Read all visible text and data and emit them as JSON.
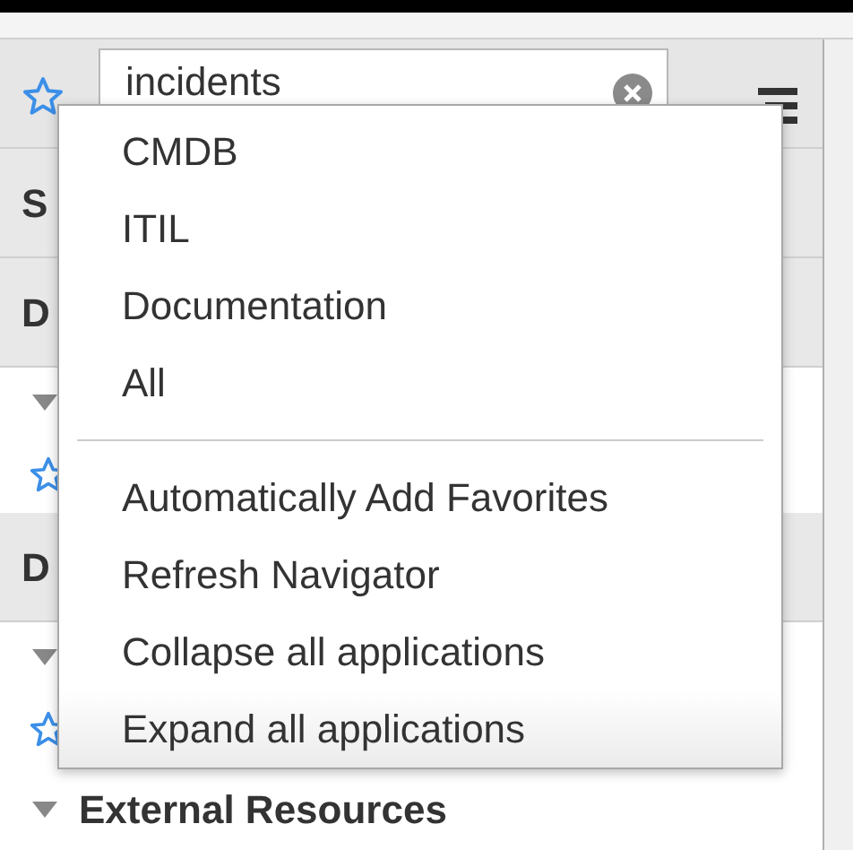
{
  "search": {
    "value": "incidents"
  },
  "sections": [
    {
      "kind": "header",
      "label": "S"
    },
    {
      "kind": "header",
      "label": "D"
    },
    {
      "kind": "expander"
    },
    {
      "kind": "favorite"
    },
    {
      "kind": "header",
      "label": "D"
    },
    {
      "kind": "expander"
    },
    {
      "kind": "favorite"
    },
    {
      "kind": "group",
      "label": "External Resources"
    }
  ],
  "menu": {
    "items": [
      {
        "kind": "item",
        "label": "CMDB",
        "selected": false
      },
      {
        "kind": "item",
        "label": "ITIL",
        "selected": false
      },
      {
        "kind": "item",
        "label": "Documentation",
        "selected": false
      },
      {
        "kind": "item",
        "label": "All",
        "selected": false
      },
      {
        "kind": "separator"
      },
      {
        "kind": "item",
        "label": "Automatically Add Favorites",
        "selected": false
      },
      {
        "kind": "item",
        "label": "Refresh Navigator",
        "selected": false
      },
      {
        "kind": "item",
        "label": "Collapse all applications",
        "selected": false
      },
      {
        "kind": "item",
        "label": "Expand all applications",
        "selected": true
      }
    ]
  }
}
